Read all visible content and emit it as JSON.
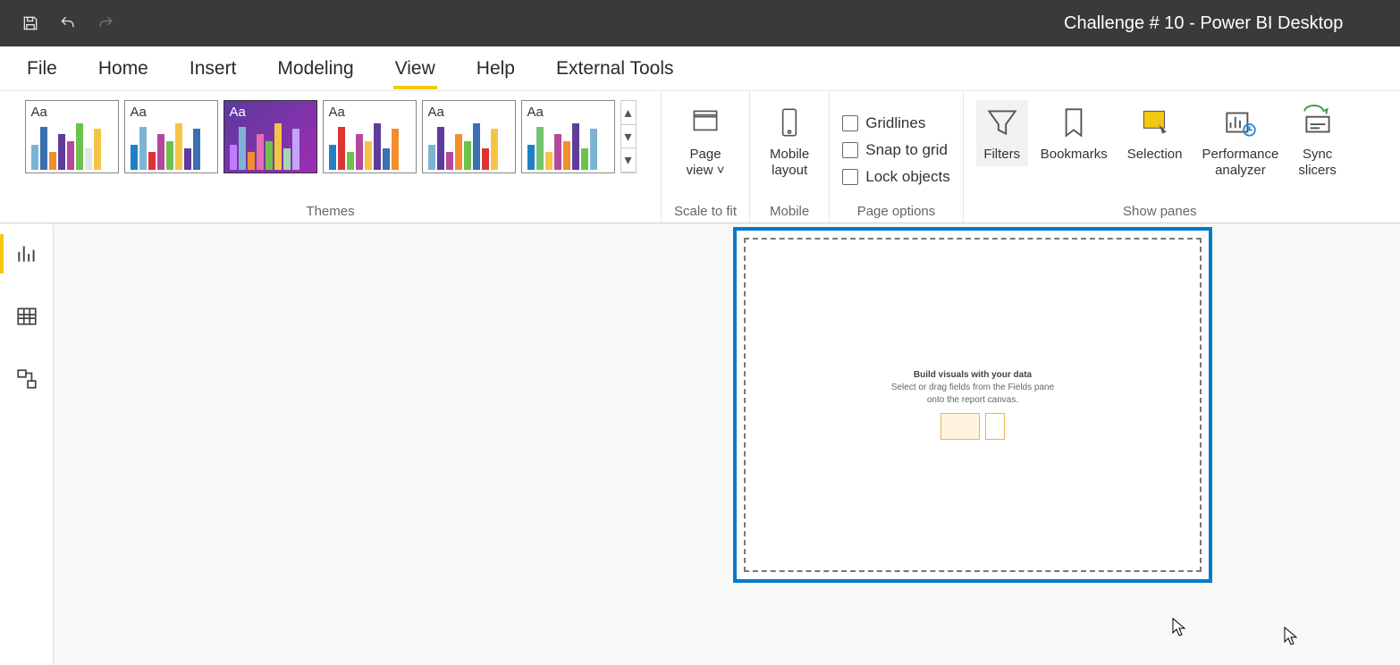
{
  "title": "Challenge # 10 - Power BI Desktop",
  "menu": {
    "file": "File",
    "home": "Home",
    "insert": "Insert",
    "modeling": "Modeling",
    "view": "View",
    "help": "Help",
    "external": "External Tools"
  },
  "ribbon": {
    "groups": {
      "themes": "Themes",
      "scale": "Scale to fit",
      "mobile": "Mobile",
      "pageoptions": "Page options",
      "showpanes": "Show panes"
    },
    "pageview_line1": "Page",
    "pageview_line2": "view",
    "mobile_line1": "Mobile",
    "mobile_line2": "layout",
    "gridlines": "Gridlines",
    "snap": "Snap to grid",
    "lock": "Lock objects",
    "filters": "Filters",
    "bookmarks": "Bookmarks",
    "selection": "Selection",
    "perf1": "Performance",
    "perf2": "analyzer",
    "sync1": "Sync",
    "sync2": "slicers"
  },
  "canvas": {
    "heading": "Build visuals with your data",
    "body1": "Select or drag fields from the Fields pane",
    "body2": "onto the report canvas."
  },
  "themes": [
    {
      "aa": "Aa",
      "selected": false,
      "bg": "#fff",
      "bars": [
        "#7db4d4",
        "#3a6fb0",
        "#f28e2b",
        "#5f3b9c",
        "#b5489e",
        "#6cc24a",
        "#e5e5e5",
        "#f6c445"
      ]
    },
    {
      "aa": "Aa",
      "selected": false,
      "bg": "#fff",
      "bars": [
        "#2080c4",
        "#7db4d4",
        "#d33",
        "#b5489e",
        "#6cc24a",
        "#f6c445",
        "#5f3b9c",
        "#3a6fb0"
      ]
    },
    {
      "aa": "Aa",
      "selected": true,
      "bg": "grad",
      "bars": [
        "#c07bff",
        "#7db4d4",
        "#f28e2b",
        "#e56fb3",
        "#6cc24a",
        "#f6c445",
        "#a3d9b1",
        "#c3a4f6"
      ]
    },
    {
      "aa": "Aa",
      "selected": false,
      "bg": "#fff",
      "bars": [
        "#2080c4",
        "#d33",
        "#6cc24a",
        "#b5489e",
        "#f6c445",
        "#5f3b9c",
        "#3a6fb0",
        "#f28e2b"
      ]
    },
    {
      "aa": "Aa",
      "selected": false,
      "bg": "#fff",
      "bars": [
        "#7db4d4",
        "#5f3b9c",
        "#b5489e",
        "#f28e2b",
        "#6cc24a",
        "#3a6fb0",
        "#d33",
        "#f6c445"
      ]
    },
    {
      "aa": "Aa",
      "selected": false,
      "bg": "#fff",
      "bars": [
        "#2080c4",
        "#73c36e",
        "#f6c445",
        "#b5489e",
        "#f28e2b",
        "#5f3b9c",
        "#6cc24a",
        "#7db4d4"
      ]
    }
  ]
}
